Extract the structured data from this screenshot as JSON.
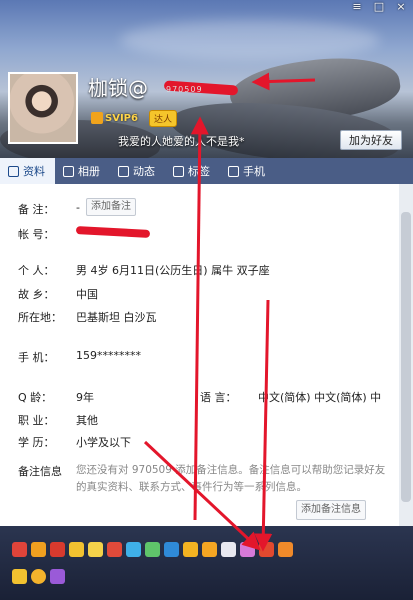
{
  "header": {
    "nickname": "枷锁@",
    "vip_label": "SVIP6",
    "daren_label": "达人",
    "signature": "我爱的人她爱的人不是我*",
    "add_friend_label": "加为好友",
    "redacted_hint": "970509"
  },
  "window_buttons": [
    "≡",
    "□",
    "×"
  ],
  "tabs": [
    {
      "icon": "profile-icon",
      "label": "资料"
    },
    {
      "icon": "photo-icon",
      "label": "相册"
    },
    {
      "icon": "feed-icon",
      "label": "动态"
    },
    {
      "icon": "tag-icon",
      "label": "标签"
    },
    {
      "icon": "phone-icon",
      "label": "手机"
    }
  ],
  "profile": {
    "remark_label": "备 注：",
    "remark_value": "-",
    "add_remark_small": "添加备注",
    "account_label": "帐 号：",
    "personal_label": "个 人：",
    "personal_value": "男   4岁   6月11日(公历生日)   属牛   双子座",
    "hometown_label": "故 乡：",
    "hometown_value": "中国",
    "location_label": "所在地：",
    "location_value": "巴基斯坦 白沙瓦",
    "phone_label": "手 机：",
    "phone_value": "159********",
    "qage_label": "Q 龄：",
    "qage_value": "9年",
    "language_label": "语 言：",
    "language_value": "中文(简体)  中文(简体)  中",
    "job_label": "职 业：",
    "job_value": "其他",
    "education_label": "学 历：",
    "education_value": "小学及以下",
    "remarks_info_label": "备注信息",
    "remarks_info_text": "您还没有对 970509 添加备注信息。备注信息可以帮助您记录好友的真实资料、联系方式、事件行为等一系列信息。",
    "add_remark_button": "添加备注信息"
  },
  "badge_icons": [
    "heart-badge",
    "trophy-badge",
    "diamond-badge",
    "game-badge",
    "gift-badge",
    "music-badge",
    "video-badge",
    "chat-badge",
    "shield-badge",
    "star-badge",
    "book-badge",
    "gem-badge",
    "crystal-badge",
    "crown-badge",
    "flame-badge",
    "star2-badge",
    "coin-badge",
    "pet-badge"
  ]
}
